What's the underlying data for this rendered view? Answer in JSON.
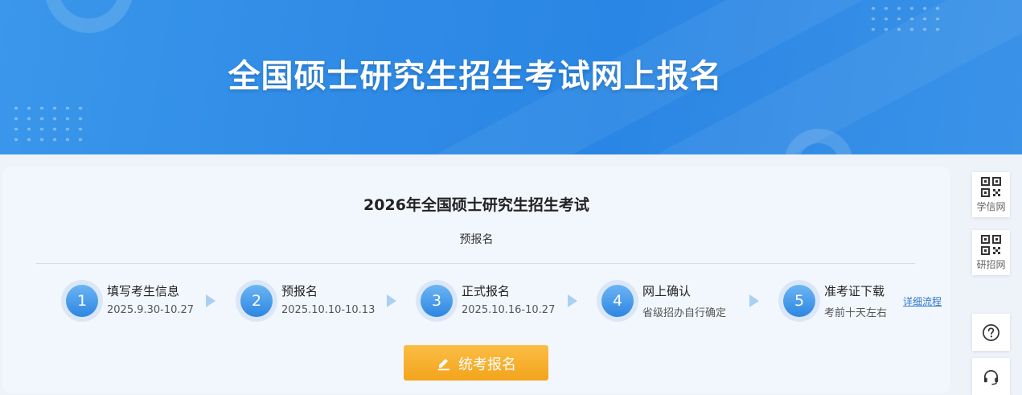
{
  "banner": {
    "title": "全国硕士研究生招生考试网上报名"
  },
  "card": {
    "title": "2026年全国硕士研究生招生考试",
    "subtitle": "预报名",
    "steps": [
      {
        "number": "1",
        "name": "填写考生信息",
        "date": "2025.9.30-10.27"
      },
      {
        "number": "2",
        "name": "预报名",
        "date": "2025.10.10-10.13"
      },
      {
        "number": "3",
        "name": "正式报名",
        "date": "2025.10.16-10.27"
      },
      {
        "number": "4",
        "name": "网上确认",
        "date": "省级招办自行确定"
      },
      {
        "number": "5",
        "name": "准考证下载",
        "date": "考前十天左右"
      }
    ],
    "detail_link": "详细流程",
    "apply_button": "统考报名"
  },
  "sidebar": {
    "xuexin_label": "学信网",
    "yanzhao_label": "研招网",
    "help_icon": "question-icon",
    "service_icon": "headset-icon"
  },
  "colors": {
    "banner_blue": "#2f8be6",
    "step_blue": "#2d86e2",
    "button_orange": "#f3a41c",
    "link_blue": "#2f78c8"
  }
}
